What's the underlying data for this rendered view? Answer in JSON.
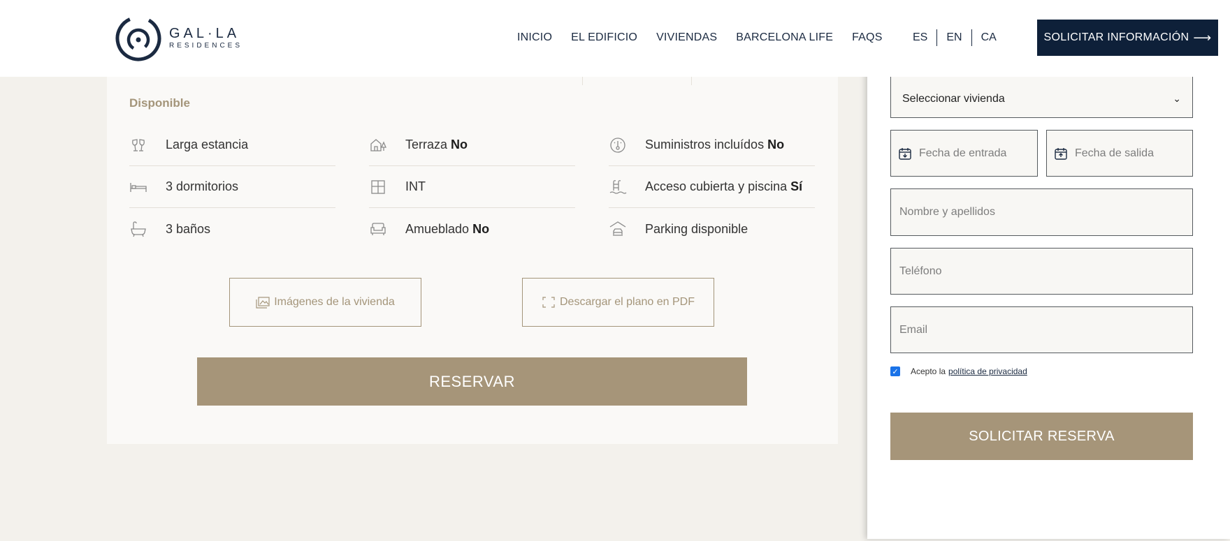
{
  "brand": {
    "name": "GAL·LA",
    "subtitle": "RESIDENCES",
    "color": "#1b2a41"
  },
  "nav": {
    "items": [
      "INICIO",
      "EL EDIFICIO",
      "VIVIENDAS",
      "BARCELONA LIFE",
      "FAQS"
    ]
  },
  "languages": [
    "ES",
    "EN",
    "CA"
  ],
  "header": {
    "cta_label": "SOLICITAR INFORMACIÓN",
    "cta_icon": "arrow-right-icon",
    "cta_color": "#0e2039"
  },
  "property": {
    "status": "Disponible",
    "features": [
      {
        "icon": "glasses-cheers-icon",
        "label": "Larga estancia",
        "value": ""
      },
      {
        "icon": "house-tree-icon",
        "label": "Terraza",
        "value": "No"
      },
      {
        "icon": "thermometer-icon",
        "label": "Suministros incluídos",
        "value": "No"
      },
      {
        "icon": "bed-icon",
        "label": "3 dormitorios",
        "value": ""
      },
      {
        "icon": "window-icon",
        "label": "INT",
        "value": ""
      },
      {
        "icon": "pool-ladder-icon",
        "label": "Acceso cubierta y piscina",
        "value": "Sí"
      },
      {
        "icon": "bathtub-icon",
        "label": "3 baños",
        "value": ""
      },
      {
        "icon": "sofa-icon",
        "label": "Amueblado",
        "value": "No"
      },
      {
        "icon": "garage-car-icon",
        "label": "Parking disponible",
        "value": ""
      }
    ],
    "images_button": "Imágenes de la vivienda",
    "plan_button": "Descargar el plano en PDF",
    "reserve_button": "RESERVAR",
    "accent_color": "#a69579"
  },
  "booking_form": {
    "select_value": "Seleccionar vivienda",
    "checkin_placeholder": "Fecha de entrada",
    "checkout_placeholder": "Fecha de salida",
    "name_placeholder": "Nombre y apellidos",
    "phone_placeholder": "Teléfono",
    "email_placeholder": "Email",
    "privacy_checked": true,
    "privacy_text": "Acepto la",
    "privacy_link": "política de privacidad",
    "submit_label": "SOLICITAR RESERVA"
  }
}
